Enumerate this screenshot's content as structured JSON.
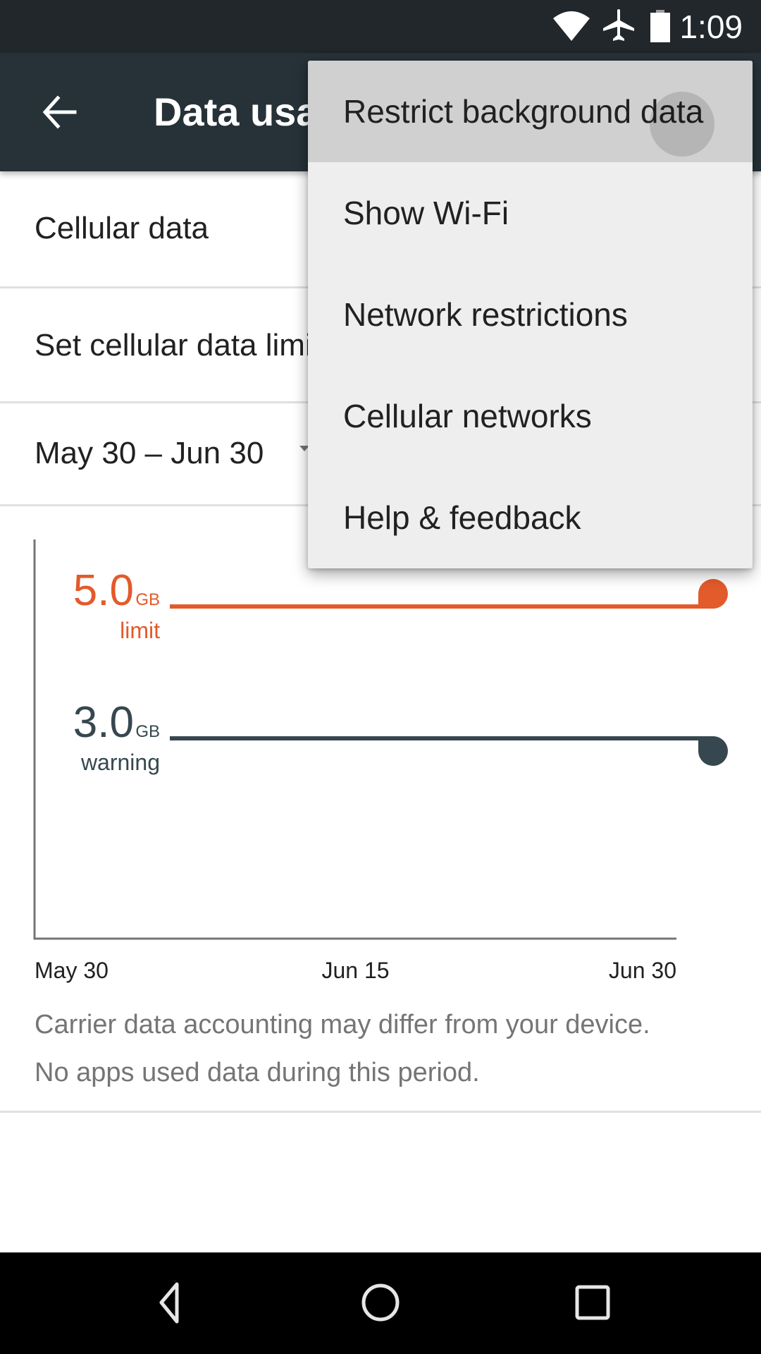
{
  "status_bar": {
    "time": "1:09",
    "icons": [
      "wifi-icon",
      "airplane-mode-icon",
      "battery-icon"
    ]
  },
  "toolbar": {
    "title": "Data usage",
    "back_icon": "arrow-left-icon"
  },
  "settings": {
    "cellular_data_label": "Cellular data",
    "set_limit_label": "Set cellular data limit",
    "billing_cycle_label": "May 30 – Jun 30",
    "billing_cycle_icon": "dropdown-triangle-icon"
  },
  "chart_data": {
    "type": "line",
    "title": "",
    "x_tick_labels": [
      "May 30",
      "Jun 15",
      "Jun 30"
    ],
    "x_range": [
      "May 30",
      "Jun 30"
    ],
    "unit": "GB",
    "thresholds": [
      {
        "name": "limit",
        "label": "limit",
        "value": 5.0,
        "value_text": "5.0",
        "color": "#e35a2b"
      },
      {
        "name": "warning",
        "label": "warning",
        "value": 3.0,
        "value_text": "3.0",
        "color": "#37474f"
      }
    ],
    "series": [],
    "grid": false
  },
  "captions": {
    "line1": "Carrier data accounting may differ from your device.",
    "line2": "No apps used data during this period."
  },
  "overflow_menu": {
    "items": [
      {
        "label": "Restrict background data",
        "pressed": true
      },
      {
        "label": "Show Wi-Fi",
        "pressed": false
      },
      {
        "label": "Network restrictions",
        "pressed": false
      },
      {
        "label": "Cellular networks",
        "pressed": false
      },
      {
        "label": "Help & feedback",
        "pressed": false
      }
    ]
  },
  "nav_bar": {
    "buttons": [
      "back-triangle-icon",
      "home-circle-icon",
      "recents-square-icon"
    ]
  },
  "colors": {
    "status_bar": "#22272b",
    "toolbar": "#263238",
    "limit": "#e35a2b",
    "warning": "#37474f",
    "menu_background": "#eeeeee",
    "menu_pressed": "#d0d0d0"
  }
}
